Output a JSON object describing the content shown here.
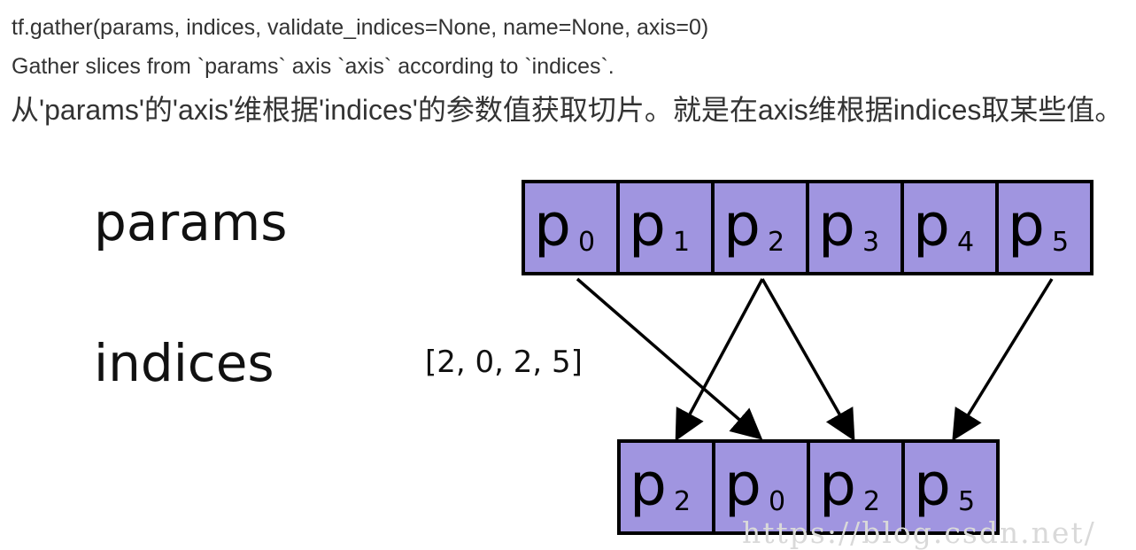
{
  "text": {
    "signature": "tf.gather(params, indices, validate_indices=None, name=None, axis=0)",
    "description_en": "Gather slices from `params` axis `axis` according to `indices`.",
    "description_zh": "从'params'的'axis'维根据'indices'的参数值获取切片。就是在axis维根据indices取某些值。"
  },
  "diagram": {
    "params_label": "params",
    "indices_label": "indices",
    "indices_value": "[2, 0, 2, 5]",
    "cell_fill": "#a095e0",
    "params": [
      {
        "base": "p",
        "sub": "0"
      },
      {
        "base": "p",
        "sub": "1"
      },
      {
        "base": "p",
        "sub": "2"
      },
      {
        "base": "p",
        "sub": "3"
      },
      {
        "base": "p",
        "sub": "4"
      },
      {
        "base": "p",
        "sub": "5"
      }
    ],
    "output": [
      {
        "base": "p",
        "sub": "2"
      },
      {
        "base": "p",
        "sub": "0"
      },
      {
        "base": "p",
        "sub": "2"
      },
      {
        "base": "p",
        "sub": "5"
      }
    ],
    "mapping": [
      2,
      0,
      2,
      5
    ]
  },
  "watermark": "https://blog.csdn.net/"
}
